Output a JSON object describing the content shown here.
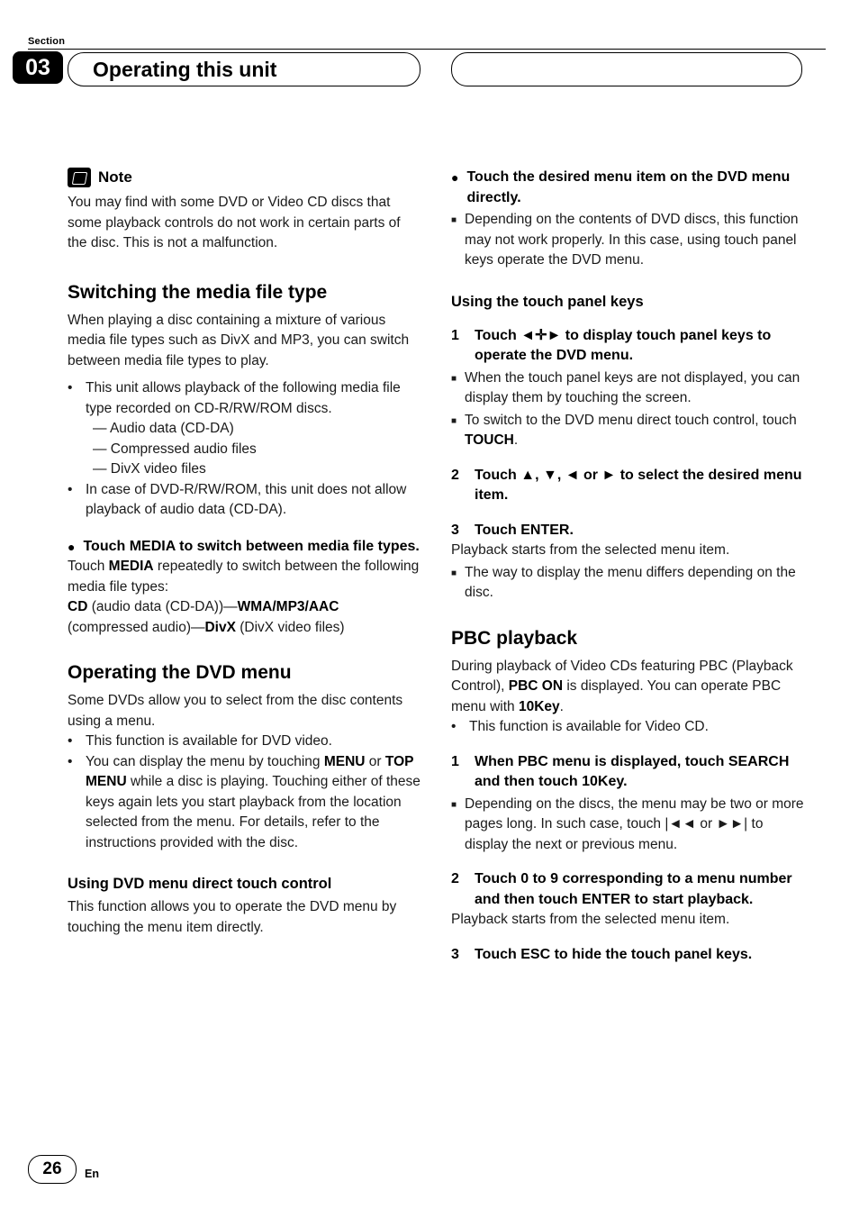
{
  "header": {
    "section_label": "Section",
    "section_number": "03",
    "title": "Operating this unit"
  },
  "footer": {
    "page_number": "26",
    "language": "En"
  },
  "left_column": {
    "note": {
      "title": "Note",
      "body": "You may find with some DVD or Video CD discs that some playback controls do not work in certain parts of the disc. This is not a malfunction."
    },
    "switching": {
      "heading": "Switching the media file type",
      "intro": "When playing a disc containing a mixture of various media file types such as DivX and MP3, you can switch between media file types to play.",
      "bullet1": "This unit allows playback of the following media file type recorded on CD-R/RW/ROM discs.",
      "dash1": "— Audio data (CD-DA)",
      "dash2": "— Compressed audio files",
      "dash3": "— DivX video files",
      "bullet2": "In case of DVD-R/RW/ROM, this unit does not allow playback of audio data (CD-DA).",
      "circle_head": "Touch MEDIA to switch between media file types.",
      "para_pre": "Touch ",
      "para_bold1": "MEDIA",
      "para_mid": " repeatedly to switch between the following media file types:",
      "line_cd_bold": "CD",
      "line_cd_mid": " (audio data (CD-DA))—",
      "line_cd_bold2": "WMA/MP3/AAC",
      "line_cd_mid2": " (compressed audio)—",
      "line_cd_bold3": "DivX",
      "line_cd_end": " (DivX video files)"
    },
    "dvd_menu": {
      "heading": "Operating the DVD menu",
      "intro": "Some DVDs allow you to select from the disc contents using a menu.",
      "bullet1": "This function is available for DVD video.",
      "bullet2_pre": "You can display the menu by touching ",
      "bullet2_b1": "MENU",
      "bullet2_mid": " or ",
      "bullet2_b2": "TOP MENU",
      "bullet2_end": " while a disc is playing. Touching either of these keys again lets you start playback from the location selected from the menu. For details, refer to the instructions provided with the disc."
    },
    "direct_touch": {
      "heading": "Using DVD menu direct touch control",
      "body": "This function allows you to operate the DVD menu by touching the menu item directly."
    }
  },
  "right_column": {
    "top": {
      "circle_head": "Touch the desired menu item on the DVD menu directly.",
      "sq1": "Depending on the contents of DVD discs, this function may not work properly. In this case, using touch panel keys operate the DVD menu."
    },
    "touch_panel": {
      "heading": "Using the touch panel keys",
      "step1_num": "1",
      "step1_pre": "Touch ",
      "step1_icon": "◄✛►",
      "step1_end": " to display touch panel keys to operate the DVD menu.",
      "sq1": "When the touch panel keys are not displayed, you can display them by touching the screen.",
      "sq2_pre": "To switch to the DVD menu direct touch control, touch ",
      "sq2_bold": "TOUCH",
      "sq2_end": ".",
      "step2_num": "2",
      "step2_text": "Touch ▲, ▼, ◄ or ► to select the desired menu item.",
      "step3_num": "3",
      "step3_text": "Touch ENTER.",
      "step3_body": "Playback starts from the selected menu item.",
      "sq3": "The way to display the menu differs depending on the disc."
    },
    "pbc": {
      "heading": "PBC playback",
      "intro_pre": "During playback of Video CDs featuring PBC (Playback Control), ",
      "intro_b1": "PBC ON",
      "intro_mid": " is displayed. You can operate PBC menu with ",
      "intro_b2": "10Key",
      "intro_end": ".",
      "bullet1": "This function is available for Video CD.",
      "step1_num": "1",
      "step1_text": "When PBC menu is displayed, touch SEARCH and then touch 10Key.",
      "sq1_pre": "Depending on the discs, the menu may be two or more pages long. In such case, touch ",
      "sq1_icon1": "|◄◄",
      "sq1_mid": " or ",
      "sq1_icon2": "►►|",
      "sq1_end": " to display the next or previous menu.",
      "step2_num": "2",
      "step2_text": "Touch 0 to 9 corresponding to a menu number and then touch ENTER to start playback.",
      "step2_body": "Playback starts from the selected menu item.",
      "step3_num": "3",
      "step3_text": "Touch ESC to hide the touch panel keys."
    }
  }
}
